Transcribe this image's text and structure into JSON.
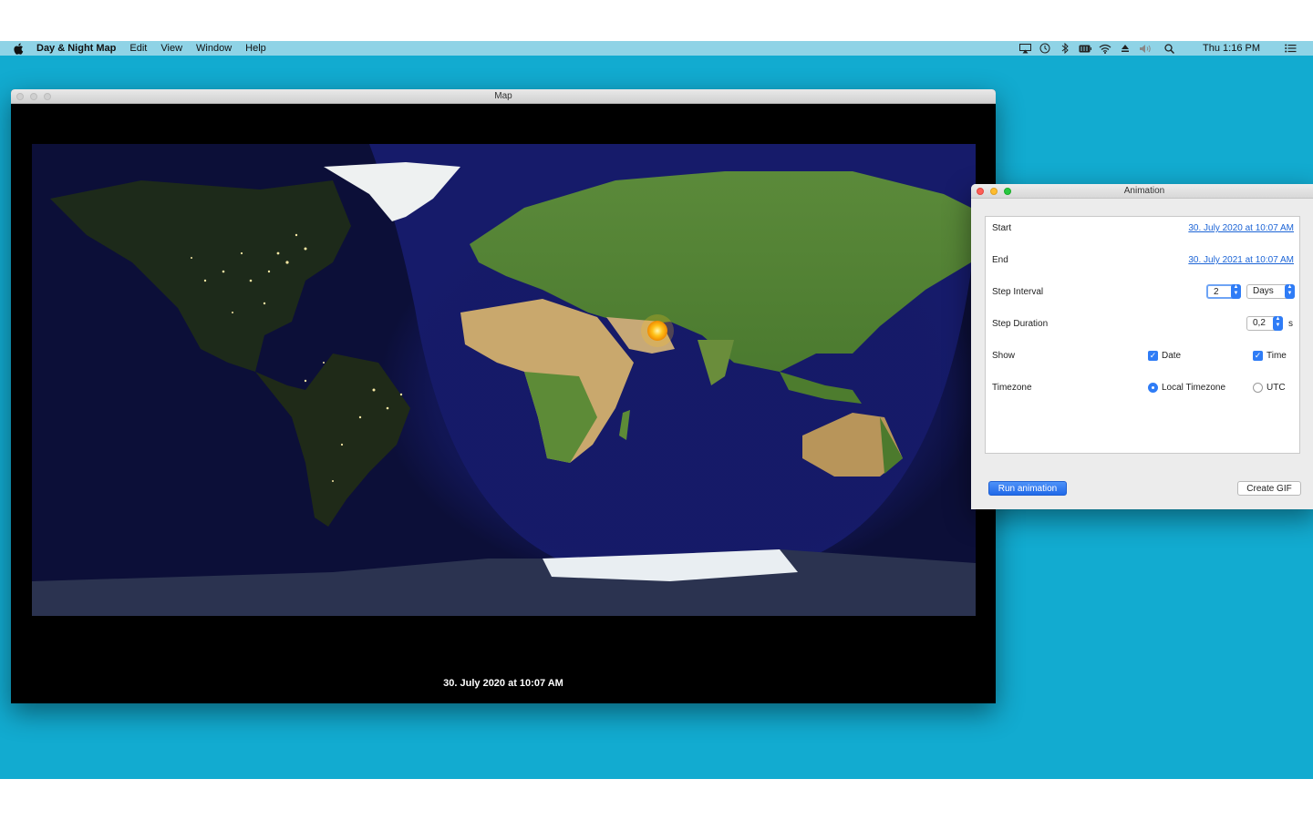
{
  "menubar": {
    "apple_icon": "apple-logo",
    "app_name": "Day & Night Map",
    "menus": [
      "Edit",
      "View",
      "Window",
      "Help"
    ],
    "status_icons": [
      "airplay-icon",
      "time-machine-icon",
      "bluetooth-icon",
      "battery-icon",
      "wifi-icon",
      "eject-icon",
      "volume-icon",
      "search-icon"
    ],
    "clock": "Thu 1:16 PM",
    "list_icon": "notification-center-icon"
  },
  "map_window": {
    "title": "Map",
    "caption": "30. July 2020 at 10:07 AM",
    "sun_icon": "sun-icon"
  },
  "animation_window": {
    "title": "Animation",
    "start": {
      "label": "Start",
      "value": "30. July 2020 at 10:07 AM"
    },
    "end": {
      "label": "End",
      "value": "30. July 2021 at 10:07 AM"
    },
    "step_interval": {
      "label": "Step Interval",
      "value": "2",
      "unit_selected": "Days"
    },
    "step_duration": {
      "label": "Step Duration",
      "value": "0,2",
      "unit": "s"
    },
    "show": {
      "label": "Show",
      "date_label": "Date",
      "date_checked": true,
      "time_label": "Time",
      "time_checked": true
    },
    "timezone": {
      "label": "Timezone",
      "local_label": "Local Timezone",
      "utc_label": "UTC",
      "selected": "Local Timezone"
    },
    "run_button": "Run animation",
    "gif_button": "Create GIF"
  },
  "colors": {
    "desktop": "#12abd0",
    "ocean": "#10123e",
    "accent": "#2f7cf6"
  }
}
